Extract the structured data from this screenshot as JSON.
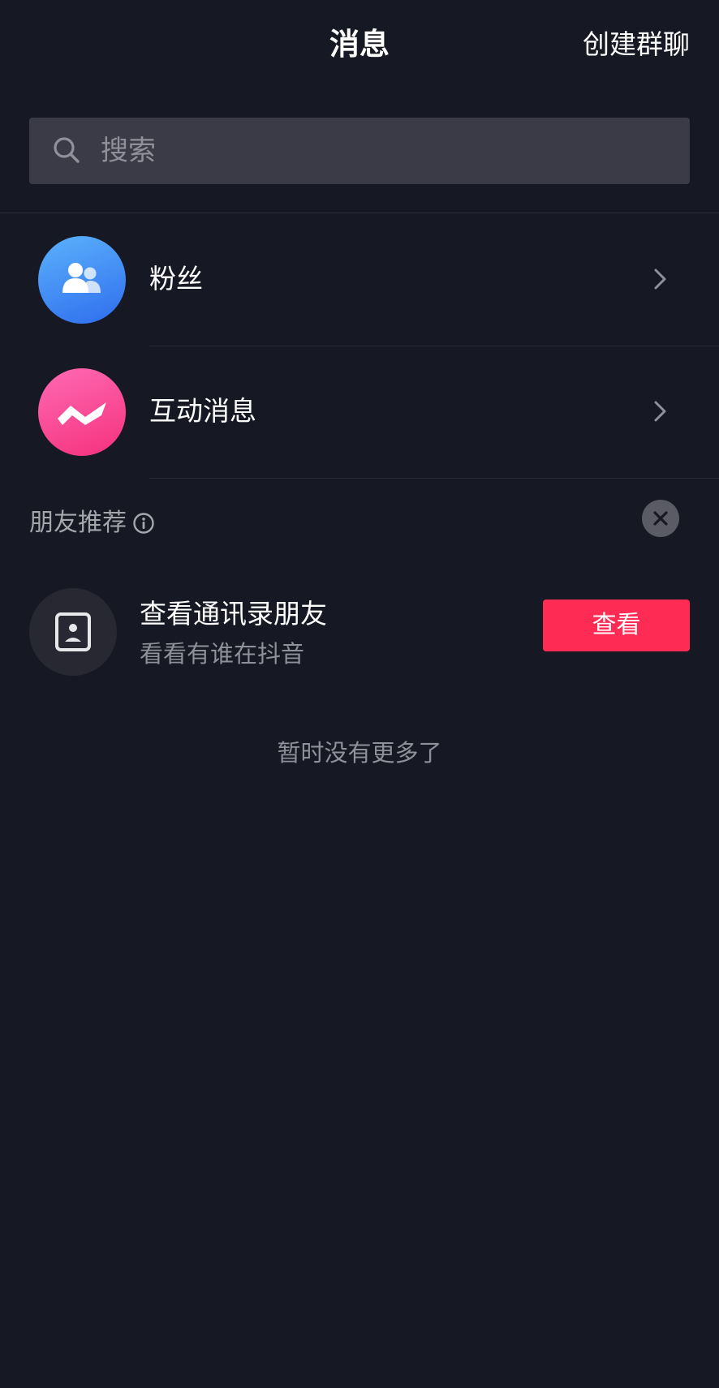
{
  "header": {
    "title": "消息",
    "action_label": "创建群聊"
  },
  "search": {
    "placeholder": "搜索",
    "icon": "search-icon"
  },
  "entries": [
    {
      "label": "粉丝",
      "icon": "fans-icon",
      "color": "#3a8cf5"
    },
    {
      "label": "互动消息",
      "icon": "interaction-icon",
      "color": "#f8428e"
    }
  ],
  "recommend": {
    "title": "朋友推荐",
    "info_icon": "info-icon",
    "close_icon": "close-icon",
    "contact": {
      "title": "查看通讯录朋友",
      "subtitle": "看看有谁在抖音",
      "icon": "contact-book-icon",
      "button_label": "查看",
      "button_color": "#fe2c55"
    }
  },
  "footer_note": "暂时没有更多了",
  "colors": {
    "background": "#161823",
    "search_bg": "#3a3b47",
    "accent": "#fe2c55"
  }
}
